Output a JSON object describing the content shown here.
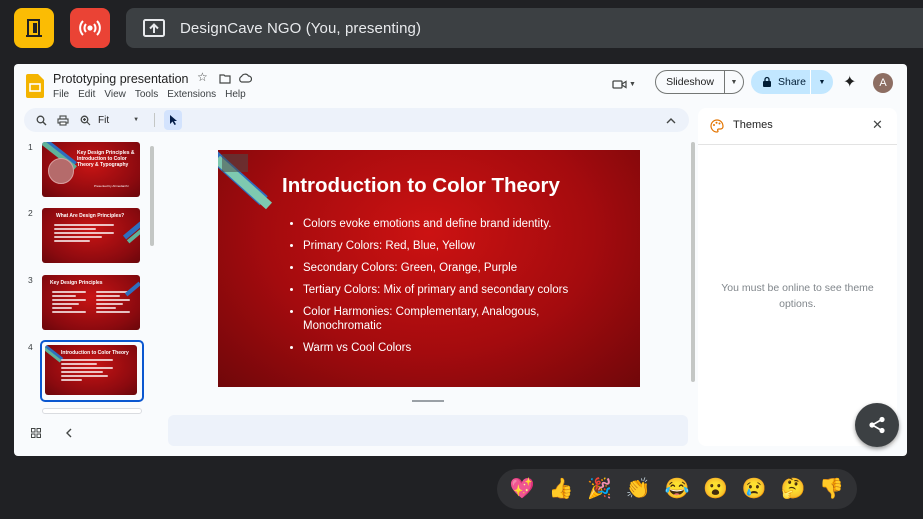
{
  "meet": {
    "presenting_label": "DesignCave NGO (You, presenting)",
    "colors": {
      "leave": "#fbbc04",
      "broadcast": "#ea4335",
      "bar": "#3c4043"
    }
  },
  "slides_app": {
    "doc_title": "Prototyping presentation",
    "menu": [
      "File",
      "Edit",
      "View",
      "Tools",
      "Extensions",
      "Help"
    ],
    "slideshow_label": "Slideshow",
    "share_label": "Share",
    "avatar_letter": "A",
    "zoom_value": "Fit"
  },
  "thumbnails": [
    {
      "number": "1",
      "title": "Key Design Principles & Introduction to Color Theory & Typography",
      "subtitle": "Presented by Ahmedanthr"
    },
    {
      "number": "2",
      "title": "What Are Design Principles?"
    },
    {
      "number": "3",
      "title": "Key Design Principles"
    },
    {
      "number": "4",
      "title": "Introduction to Color Theory"
    }
  ],
  "current_slide": {
    "title": "Introduction to Color Theory",
    "bullets": [
      "Colors evoke emotions and define brand identity.",
      "Primary Colors: Red, Blue, Yellow",
      "Secondary Colors: Green, Orange, Purple",
      "Tertiary Colors: Mix of primary and secondary colors",
      "Color Harmonies: Complementary, Analogous, Monochromatic",
      "Warm vs Cool Colors"
    ]
  },
  "themes_panel": {
    "title": "Themes",
    "message": "You must be online to see theme options."
  },
  "reactions": [
    "💖",
    "👍",
    "🎉",
    "👏",
    "😂",
    "😮",
    "😢",
    "🤔",
    "👎"
  ]
}
